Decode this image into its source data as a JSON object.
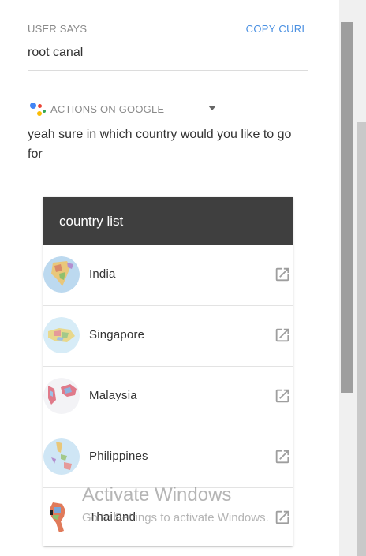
{
  "user_says": {
    "label": "USER SAYS",
    "copy_curl": "COPY CURL",
    "query": "root canal"
  },
  "agent": {
    "platform_label": "ACTIONS ON GOOGLE",
    "response": "yeah sure in which country would you like to go for"
  },
  "card": {
    "title": "country list",
    "items": [
      {
        "title": "India"
      },
      {
        "title": "Singapore"
      },
      {
        "title": "Malaysia"
      },
      {
        "title": "Philippines"
      },
      {
        "title": "Thailand"
      }
    ]
  },
  "watermark": {
    "title": "Activate Windows",
    "subtitle": "Go to Settings to activate Windows."
  },
  "colors": {
    "link": "#4a90e2",
    "header": "#3f3f3f",
    "label": "#8a8a8a"
  },
  "icons": [
    "google-assistant-logo-icon",
    "dropdown-caret-icon",
    "external-link-icon"
  ]
}
